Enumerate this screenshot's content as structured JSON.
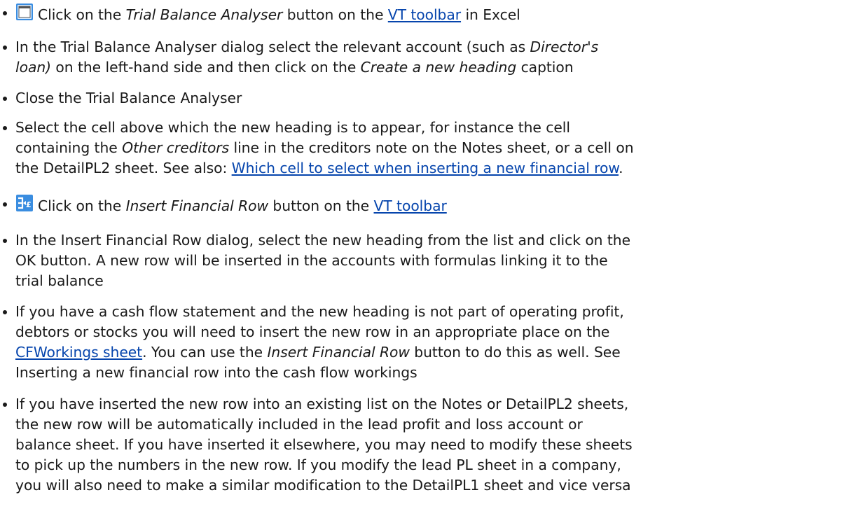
{
  "items": {
    "tba": {
      "a": "Click on the ",
      "em": "Trial Balance Analyser",
      "b": " button on the ",
      "link": "VT toolbar",
      "c": " in Excel",
      "icon": "window-icon"
    },
    "select_account": {
      "a": "In the Trial Balance Analyser dialog select the relevant account (such as ",
      "em1": "Director's",
      "em2": "loan)",
      "b": " on the left-hand side and then click on the ",
      "em3": "Create a new heading",
      "c": " caption"
    },
    "close": {
      "text": "Close the Trial Balance Analyser"
    },
    "select_cell": {
      "a": "Select the cell above which the new heading is to appear, for instance the cell",
      "b": "containing the ",
      "em": "Other creditors",
      "c": " line in the creditors note on the Notes sheet, or a cell on",
      "d": "the DetailPL2 sheet. See also: ",
      "link": "Which cell to select when inserting a new financial row",
      "e": "."
    },
    "ifr": {
      "a": "Click on the ",
      "em": "Insert Financial Row",
      "b": " button on the ",
      "link": "VT toolbar",
      "icon": "insert-row-icon"
    },
    "ifr_dialog": {
      "a": "In the Insert Financial Row dialog, select the new heading from the list and click on the",
      "b": "OK button. A new row will be inserted in the accounts with formulas linking it to the",
      "c": "trial balance"
    },
    "cash_flow": {
      "a": "If you have a cash flow statement and the new heading is not part of operating profit,",
      "b": "debtors or stocks you will need to insert the new row in an appropriate place on the",
      "link": "CFWorkings sheet",
      "c": ". You can use the ",
      "em": "Insert Financial Row",
      "d": " button to do this as well. See",
      "e": "Inserting a new financial row into the cash flow workings"
    },
    "existing_list": {
      "a": "If you have inserted the new row into an existing list on the Notes or DetailPL2 sheets,",
      "b": "the new row will be automatically included in the lead profit and loss account or",
      "c": "balance sheet. If you have inserted it elsewhere, you may need to modify these sheets",
      "d": "to pick up the numbers in the new row. If you modify the lead PL sheet in a company,",
      "e": "you will also need to make a similar modification to the DetailPL1 sheet and vice versa"
    }
  }
}
